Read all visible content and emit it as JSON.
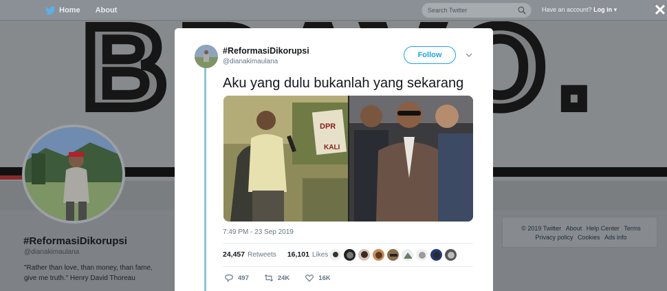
{
  "nav": {
    "home_label": "Home",
    "about_label": "About",
    "search_placeholder": "Search Twitter",
    "account_prompt": "Have an account?",
    "login_label": "Log in",
    "login_caret": "▾",
    "close_glyph": "✕"
  },
  "banner": {
    "text": "BRAVO."
  },
  "profile": {
    "name": "#ReformasiDikorupsi",
    "handle": "@dianakimaulana",
    "bio_line1": "\"Rather than love, than money, than fame,",
    "bio_line2": "give me truth.\" Henry David Thoreau"
  },
  "footer": {
    "copyright": "© 2019 Twitter",
    "about": "About",
    "help": "Help Center",
    "terms": "Terms",
    "privacy": "Privacy policy",
    "cookies": "Cookies",
    "ads": "Ads info"
  },
  "tweet": {
    "author_name": "#ReformasiDikorupsi",
    "author_handle": "@dianakimaulana",
    "follow_label": "Follow",
    "text": "Aku yang dulu bukanlah yang sekarang",
    "timestamp": "7:49 PM - 23 Sep 2019",
    "retweets_count": "24,457",
    "retweets_label": "Retweets",
    "likes_count": "16,101",
    "likes_label": "Likes",
    "reply_count": "497",
    "retweet_action_count": "24K",
    "like_action_count": "16K",
    "sign_text_1": "DPR",
    "sign_text_2": "KALI"
  },
  "colors": {
    "accent": "#1da1f2",
    "thread_line": "#88c6d9",
    "meta_text": "#657786"
  },
  "icons": {
    "logo": "twitter-bird-icon",
    "search": "search-icon",
    "close": "close-icon",
    "caret": "chevron-down-icon",
    "reply": "reply-icon",
    "retweet": "retweet-icon",
    "like": "heart-icon"
  }
}
